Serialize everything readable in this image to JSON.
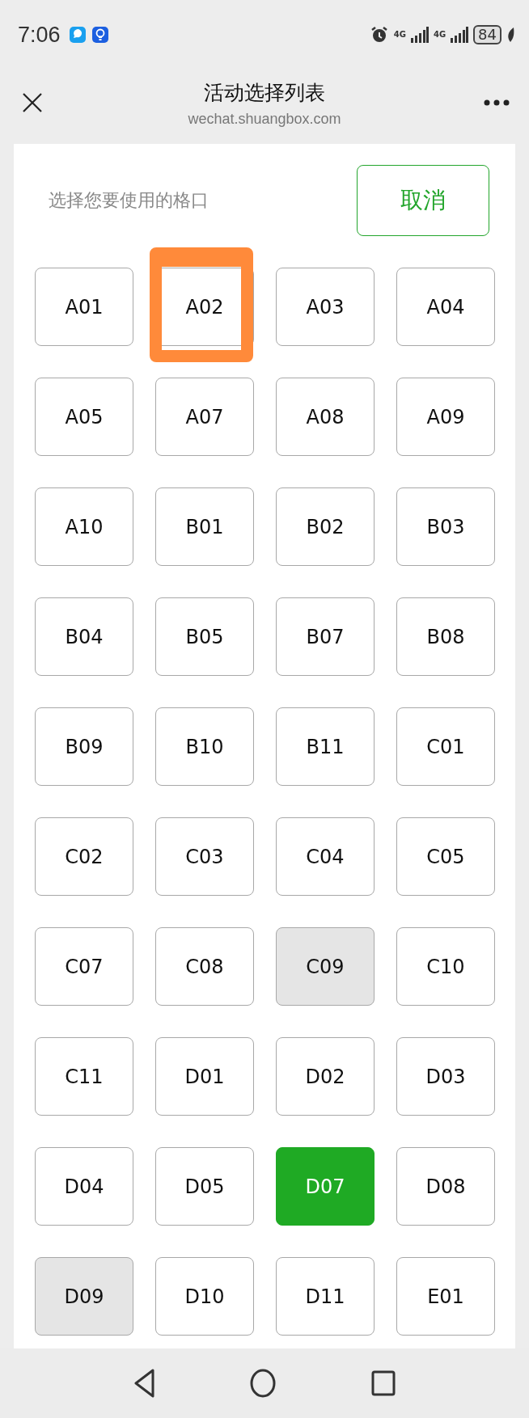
{
  "status_bar": {
    "time": "7:06",
    "network_1": "4G",
    "network_2": "4G",
    "battery": "84"
  },
  "header": {
    "title": "活动选择列表",
    "url": "wechat.shuangbox.com"
  },
  "prompt": "选择您要使用的格口",
  "cancel_button": "取消",
  "cells": [
    {
      "label": "A01",
      "selected": false,
      "disabled": false,
      "circled": false
    },
    {
      "label": "A02",
      "selected": false,
      "disabled": false,
      "circled": true
    },
    {
      "label": "A03",
      "selected": false,
      "disabled": false,
      "circled": false
    },
    {
      "label": "A04",
      "selected": false,
      "disabled": false,
      "circled": false
    },
    {
      "label": "A05",
      "selected": false,
      "disabled": false,
      "circled": false
    },
    {
      "label": "A07",
      "selected": false,
      "disabled": false,
      "circled": false
    },
    {
      "label": "A08",
      "selected": false,
      "disabled": false,
      "circled": false
    },
    {
      "label": "A09",
      "selected": false,
      "disabled": false,
      "circled": false
    },
    {
      "label": "A10",
      "selected": false,
      "disabled": false,
      "circled": false
    },
    {
      "label": "B01",
      "selected": false,
      "disabled": false,
      "circled": false
    },
    {
      "label": "B02",
      "selected": false,
      "disabled": false,
      "circled": false
    },
    {
      "label": "B03",
      "selected": false,
      "disabled": false,
      "circled": false
    },
    {
      "label": "B04",
      "selected": false,
      "disabled": false,
      "circled": false
    },
    {
      "label": "B05",
      "selected": false,
      "disabled": false,
      "circled": false
    },
    {
      "label": "B07",
      "selected": false,
      "disabled": false,
      "circled": false
    },
    {
      "label": "B08",
      "selected": false,
      "disabled": false,
      "circled": false
    },
    {
      "label": "B09",
      "selected": false,
      "disabled": false,
      "circled": false
    },
    {
      "label": "B10",
      "selected": false,
      "disabled": false,
      "circled": false
    },
    {
      "label": "B11",
      "selected": false,
      "disabled": false,
      "circled": false
    },
    {
      "label": "C01",
      "selected": false,
      "disabled": false,
      "circled": false
    },
    {
      "label": "C02",
      "selected": false,
      "disabled": false,
      "circled": false
    },
    {
      "label": "C03",
      "selected": false,
      "disabled": false,
      "circled": false
    },
    {
      "label": "C04",
      "selected": false,
      "disabled": false,
      "circled": false
    },
    {
      "label": "C05",
      "selected": false,
      "disabled": false,
      "circled": false
    },
    {
      "label": "C07",
      "selected": false,
      "disabled": false,
      "circled": false
    },
    {
      "label": "C08",
      "selected": false,
      "disabled": false,
      "circled": false
    },
    {
      "label": "C09",
      "selected": false,
      "disabled": true,
      "circled": false
    },
    {
      "label": "C10",
      "selected": false,
      "disabled": false,
      "circled": false
    },
    {
      "label": "C11",
      "selected": false,
      "disabled": false,
      "circled": false
    },
    {
      "label": "D01",
      "selected": false,
      "disabled": false,
      "circled": false
    },
    {
      "label": "D02",
      "selected": false,
      "disabled": false,
      "circled": false
    },
    {
      "label": "D03",
      "selected": false,
      "disabled": false,
      "circled": false
    },
    {
      "label": "D04",
      "selected": false,
      "disabled": false,
      "circled": false
    },
    {
      "label": "D05",
      "selected": false,
      "disabled": false,
      "circled": false
    },
    {
      "label": "D07",
      "selected": true,
      "disabled": false,
      "circled": false
    },
    {
      "label": "D08",
      "selected": false,
      "disabled": false,
      "circled": false
    },
    {
      "label": "D09",
      "selected": false,
      "disabled": true,
      "circled": false
    },
    {
      "label": "D10",
      "selected": false,
      "disabled": false,
      "circled": false
    },
    {
      "label": "D11",
      "selected": false,
      "disabled": false,
      "circled": false
    },
    {
      "label": "E01",
      "selected": false,
      "disabled": false,
      "circled": false
    }
  ]
}
